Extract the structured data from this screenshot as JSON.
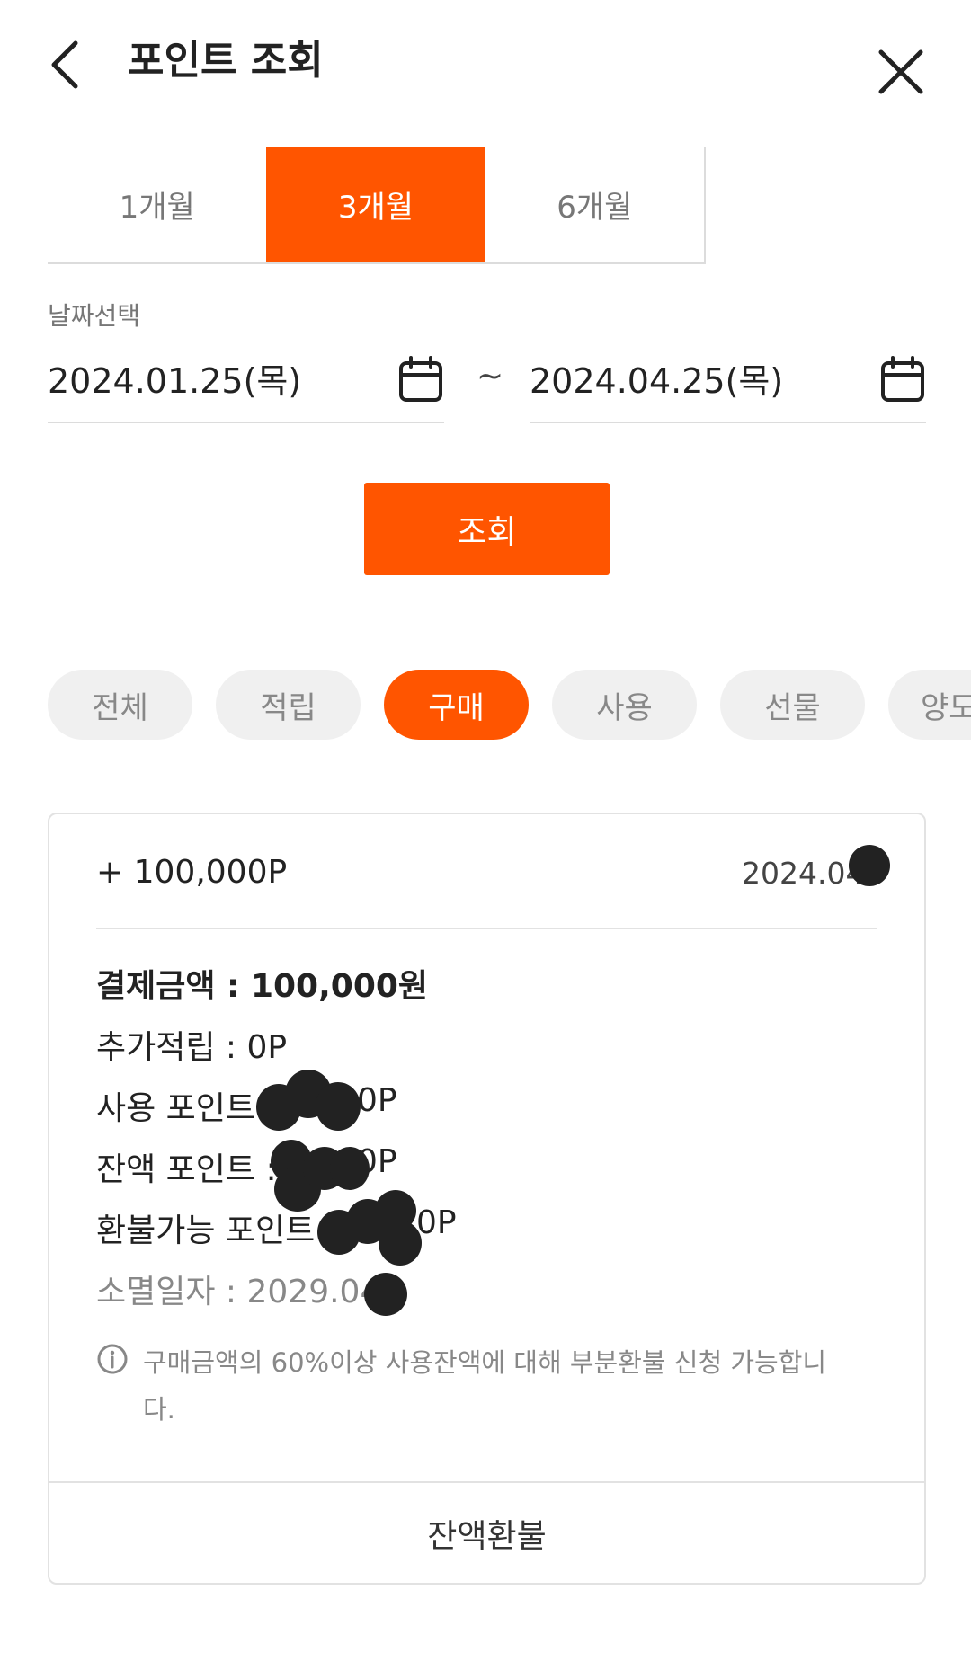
{
  "header": {
    "title": "포인트 조회",
    "back_icon": "chevron-left-icon",
    "close_icon": "close-icon"
  },
  "period_tabs": [
    {
      "label": "1개월",
      "active": false
    },
    {
      "label": "3개월",
      "active": true
    },
    {
      "label": "6개월",
      "active": false
    }
  ],
  "date_select": {
    "label": "날짜선택",
    "start": "2024.01.25(목)",
    "end": "2024.04.25(목)",
    "separator": "~",
    "calendar_icon": "calendar-icon"
  },
  "search_button": "조회",
  "filter_chips": [
    {
      "label": "전체",
      "active": false
    },
    {
      "label": "적립",
      "active": false
    },
    {
      "label": "구매",
      "active": true
    },
    {
      "label": "사용",
      "active": false
    },
    {
      "label": "선물",
      "active": false
    },
    {
      "label": "양도",
      "active": false
    }
  ],
  "record": {
    "amount": "+ 100,000P",
    "date": "2024.04.",
    "payment": "결제금액 : 100,000원",
    "extra_points": "추가적립 : 0P",
    "used_points_label": "사용 포인트",
    "used_points_suffix": "0P",
    "balance_points_label": "잔액 포인트 :",
    "balance_points_suffix": "0P",
    "refundable_points_label": "환불가능 포인트",
    "refundable_points_suffix": "0P",
    "expiry": "소멸일자 : 2029.04.",
    "notice": "구매금액의 60%이상 사용잔액에 대해 부분환불 신청 가능합니다.",
    "refund_button": "잔액환불"
  },
  "colors": {
    "accent": "#ff5500",
    "chip_bg": "#f0f0f0",
    "border": "#e2e2e2"
  }
}
